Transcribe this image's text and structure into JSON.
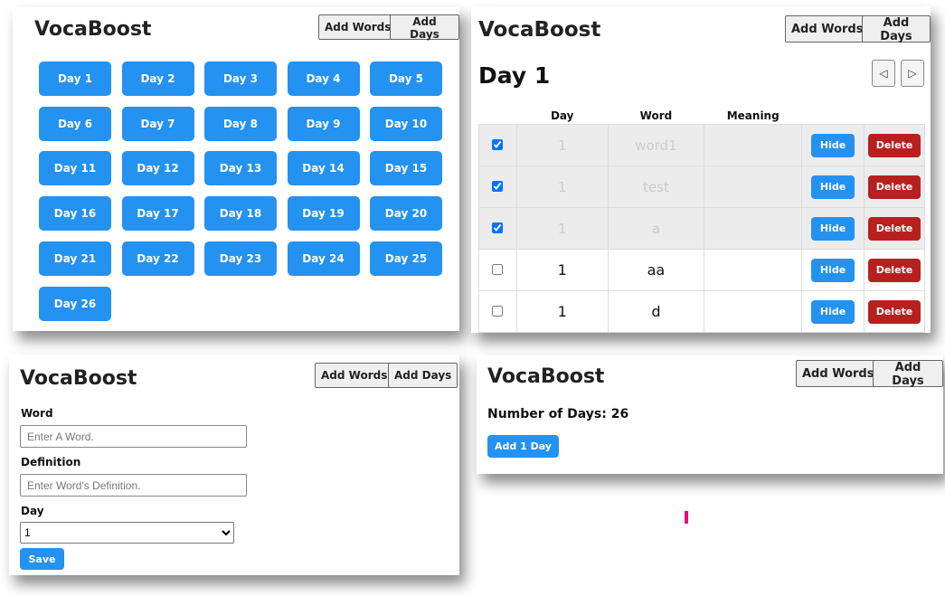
{
  "app": {
    "brand": "VocaBoost"
  },
  "nav": {
    "add_words": "Add Words",
    "add_days": "Add Days"
  },
  "day_list": {
    "days": [
      "Day 1",
      "Day 2",
      "Day 3",
      "Day 4",
      "Day 5",
      "Day 6",
      "Day 7",
      "Day 8",
      "Day 9",
      "Day 10",
      "Day 11",
      "Day 12",
      "Day 13",
      "Day 14",
      "Day 15",
      "Day 16",
      "Day 17",
      "Day 18",
      "Day 19",
      "Day 20",
      "Day 21",
      "Day 22",
      "Day 23",
      "Day 24",
      "Day 25",
      "Day 26"
    ]
  },
  "day_detail": {
    "title": "Day 1",
    "prev_icon": "◁",
    "next_icon": "▷",
    "headers": {
      "day": "Day",
      "word": "Word",
      "meaning": "Meaning"
    },
    "hide_label": "Hide",
    "delete_label": "Delete",
    "rows": [
      {
        "checked": true,
        "day": "1",
        "word": "word1",
        "meaning": ""
      },
      {
        "checked": true,
        "day": "1",
        "word": "test",
        "meaning": ""
      },
      {
        "checked": true,
        "day": "1",
        "word": "a",
        "meaning": ""
      },
      {
        "checked": false,
        "day": "1",
        "word": "aa",
        "meaning": ""
      },
      {
        "checked": false,
        "day": "1",
        "word": "d",
        "meaning": ""
      }
    ]
  },
  "add_word_form": {
    "word_label": "Word",
    "word_placeholder": "Enter A Word.",
    "definition_label": "Definition",
    "definition_placeholder": "Enter Word's Definition.",
    "day_label": "Day",
    "day_selected": "1",
    "save_label": "Save"
  },
  "add_days": {
    "count_text": "Number of Days: 26",
    "add_label": "Add 1 Day"
  },
  "colors": {
    "primary": "#2492f0",
    "danger": "#b8201f",
    "marker": "#e0107a"
  }
}
